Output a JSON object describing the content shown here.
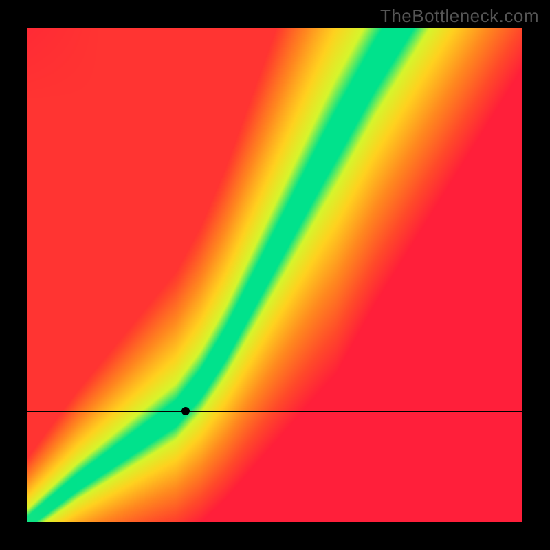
{
  "watermark": "TheBottleneck.com",
  "chart_data": {
    "type": "heatmap",
    "title": "",
    "xlabel": "",
    "ylabel": "",
    "xlim": [
      0,
      1
    ],
    "ylim": [
      0,
      1
    ],
    "grid": false,
    "legend": false,
    "marker_point": {
      "x": 0.32,
      "y": 0.225
    },
    "crosshair": {
      "x": 0.32,
      "y": 0.225
    },
    "optimal_band": {
      "description": "Green band of near-zero bottleneck along a curve; outside fades yellow→orange→red",
      "control_points": [
        {
          "x": 0.0,
          "y": 0.0
        },
        {
          "x": 0.1,
          "y": 0.08
        },
        {
          "x": 0.2,
          "y": 0.15
        },
        {
          "x": 0.3,
          "y": 0.22
        },
        {
          "x": 0.35,
          "y": 0.28
        },
        {
          "x": 0.4,
          "y": 0.36
        },
        {
          "x": 0.5,
          "y": 0.55
        },
        {
          "x": 0.6,
          "y": 0.74
        },
        {
          "x": 0.7,
          "y": 0.92
        },
        {
          "x": 0.75,
          "y": 1.0
        }
      ],
      "band_halfwidth_start": 0.012,
      "band_halfwidth_end": 0.05
    },
    "color_stops": [
      {
        "t": 0.0,
        "color": "#00e28c"
      },
      {
        "t": 0.12,
        "color": "#d6f62d"
      },
      {
        "t": 0.3,
        "color": "#ffd21f"
      },
      {
        "t": 0.55,
        "color": "#ff8a1f"
      },
      {
        "t": 0.8,
        "color": "#ff4a2a"
      },
      {
        "t": 1.0,
        "color": "#ff1f3a"
      }
    ]
  }
}
